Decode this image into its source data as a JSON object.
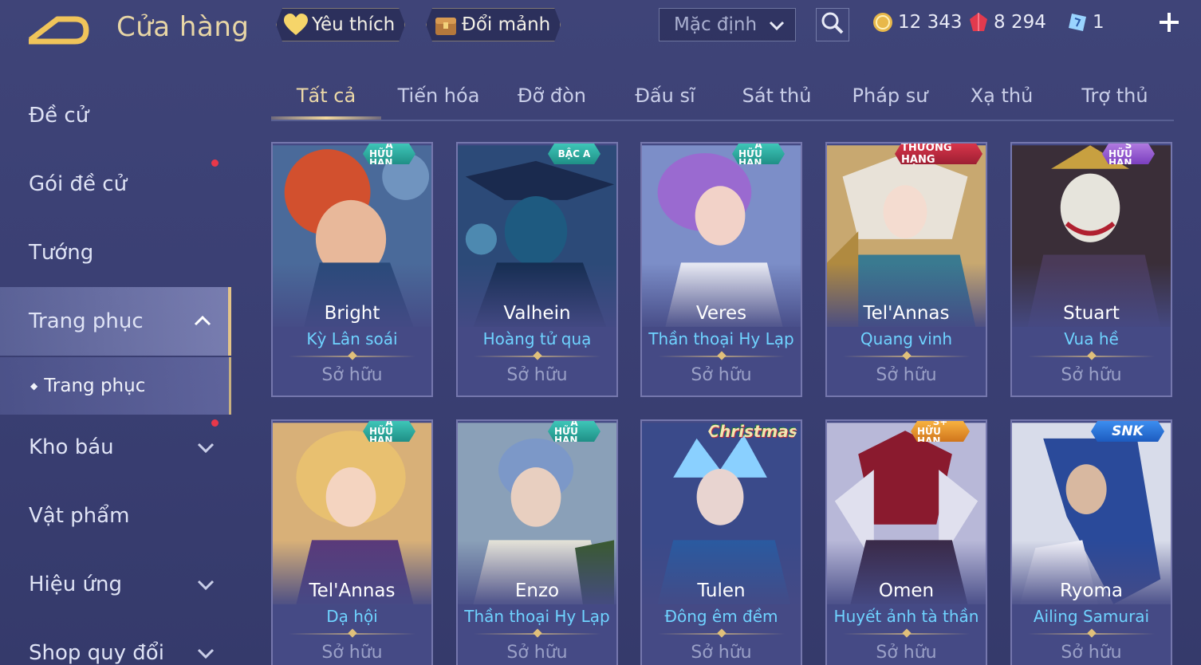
{
  "header": {
    "title": "Cửa hàng",
    "favorites_label": "Yêu thích",
    "exchange_label": "Đổi mảnh",
    "sort_value": "Mặc định",
    "currencies": [
      {
        "icon": "gold-coin-icon",
        "value": "12 343"
      },
      {
        "icon": "red-gem-icon",
        "value": "8 294"
      },
      {
        "icon": "ticket-icon",
        "value": "1"
      }
    ]
  },
  "sidebar": {
    "items": [
      {
        "label": "Đề cử"
      },
      {
        "label": "Gói đề cử"
      },
      {
        "label": "Tướng"
      },
      {
        "label": "Trang phục"
      },
      {
        "label": "Trang phục"
      },
      {
        "label": "Kho báu"
      },
      {
        "label": "Vật phẩm"
      },
      {
        "label": "Hiệu ứng"
      },
      {
        "label": "Shop quy đổi"
      }
    ]
  },
  "tabs": [
    "Tất cả",
    "Tiến hóa",
    "Đỡ đòn",
    "Đấu sĩ",
    "Sát thủ",
    "Pháp sư",
    "Xạ thủ",
    "Trợ thủ"
  ],
  "cards": [
    {
      "hero": "Bright",
      "skin": "Kỳ Lân soái",
      "status": "Sở hữu",
      "badge": "A HỮU HẠN",
      "badge_top": "A",
      "badge_bottom": "HỮU HẠN",
      "badge_style": "teal"
    },
    {
      "hero": "Valhein",
      "skin": "Hoàng tử quạ",
      "status": "Sở hữu",
      "badge": "BẬC A",
      "badge_top": "",
      "badge_bottom": "BẬC A",
      "badge_style": "teal"
    },
    {
      "hero": "Veres",
      "skin": "Thần thoại Hy Lạp",
      "status": "Sở hữu",
      "badge": "A HỮU HẠN",
      "badge_top": "A",
      "badge_bottom": "HỮU HẠN",
      "badge_style": "teal"
    },
    {
      "hero": "Tel'Annas",
      "skin": "Quang vinh",
      "status": "Sở hữu",
      "badge": "THƯỞNG HẠNG",
      "badge_top": "",
      "badge_bottom": "THƯỞNG HẠNG",
      "badge_style": "red"
    },
    {
      "hero": "Stuart",
      "skin": "Vua hề",
      "status": "Sở hữu",
      "badge": "S HỮU HẠN",
      "badge_top": "S",
      "badge_bottom": "HỮU HẠN",
      "badge_style": "purple"
    },
    {
      "hero": "Tel'Annas",
      "skin": "Dạ hội",
      "status": "Sở hữu",
      "badge": "A HỮU HẠN",
      "badge_top": "A",
      "badge_bottom": "HỮU HẠN",
      "badge_style": "teal"
    },
    {
      "hero": "Enzo",
      "skin": "Thần thoại Hy Lạp",
      "status": "Sở hữu",
      "badge": "A HỮU HẠN",
      "badge_top": "A",
      "badge_bottom": "HỮU HẠN",
      "badge_style": "teal"
    },
    {
      "hero": "Tulen",
      "skin": "Đông êm đềm",
      "status": "Sở hữu",
      "badge": "Christmas",
      "badge_top": "",
      "badge_bottom": "Christmas",
      "badge_style": "xmas"
    },
    {
      "hero": "Omen",
      "skin": "Huyết ảnh tà thần",
      "status": "Sở hữu",
      "badge": "S+ HỮU HẠN",
      "badge_top": "S+",
      "badge_bottom": "HỮU HẠN",
      "badge_style": "orange"
    },
    {
      "hero": "Ryoma",
      "skin": "Ailing Samurai",
      "status": "Sở hữu",
      "badge": "SNK",
      "badge_top": "",
      "badge_bottom": "SNK",
      "badge_style": "blue"
    }
  ],
  "colors": {
    "background": "#3c4175",
    "accent_gold": "#e4c488",
    "skin_name": "#6fd3ff",
    "notification_dot": "#e8384a"
  }
}
